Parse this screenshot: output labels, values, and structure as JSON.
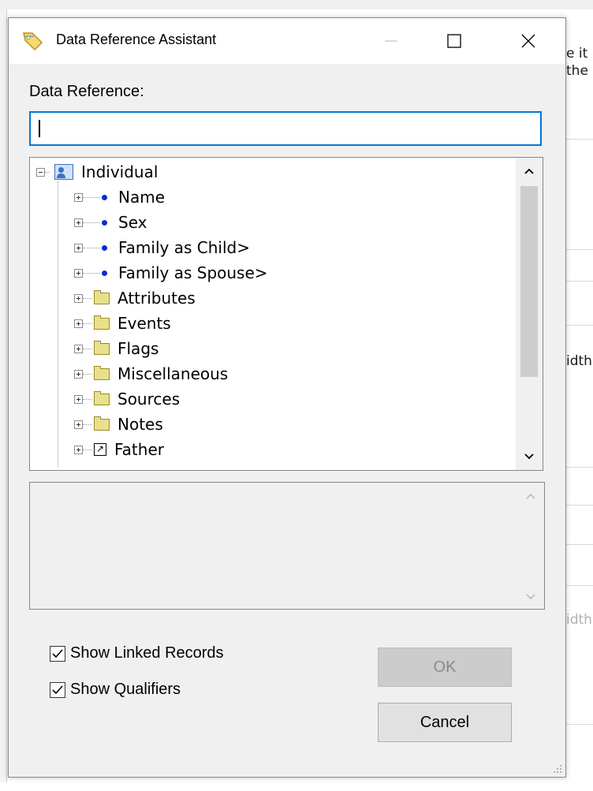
{
  "background": {
    "snippets": [
      "e it",
      "the",
      "idth",
      "idth"
    ]
  },
  "dialog": {
    "title": "Data Reference Assistant",
    "reference_label": "Data Reference:",
    "reference_value": "",
    "tree": {
      "root": "Individual",
      "children": [
        {
          "label": "Name",
          "icon": "bullet-icon"
        },
        {
          "label": "Sex",
          "icon": "bullet-icon"
        },
        {
          "label": "Family as Child>",
          "icon": "bullet-icon"
        },
        {
          "label": "Family as Spouse>",
          "icon": "bullet-icon"
        },
        {
          "label": "Attributes",
          "icon": "folder-icon"
        },
        {
          "label": "Events",
          "icon": "folder-icon"
        },
        {
          "label": "Flags",
          "icon": "folder-icon"
        },
        {
          "label": "Miscellaneous",
          "icon": "folder-icon"
        },
        {
          "label": "Sources",
          "icon": "folder-icon"
        },
        {
          "label": "Notes",
          "icon": "folder-icon"
        },
        {
          "label": "Father",
          "icon": "link-icon"
        }
      ]
    },
    "options": {
      "show_linked_records": {
        "label": "Show Linked Records",
        "checked": true
      },
      "show_qualifiers": {
        "label": "Show Qualifiers",
        "checked": true
      }
    },
    "buttons": {
      "ok_label": "OK",
      "cancel_label": "Cancel"
    }
  },
  "colors": {
    "focus_border": "#0078d7",
    "bullet": "#0a2bd6",
    "folder": "#e9e08a"
  }
}
